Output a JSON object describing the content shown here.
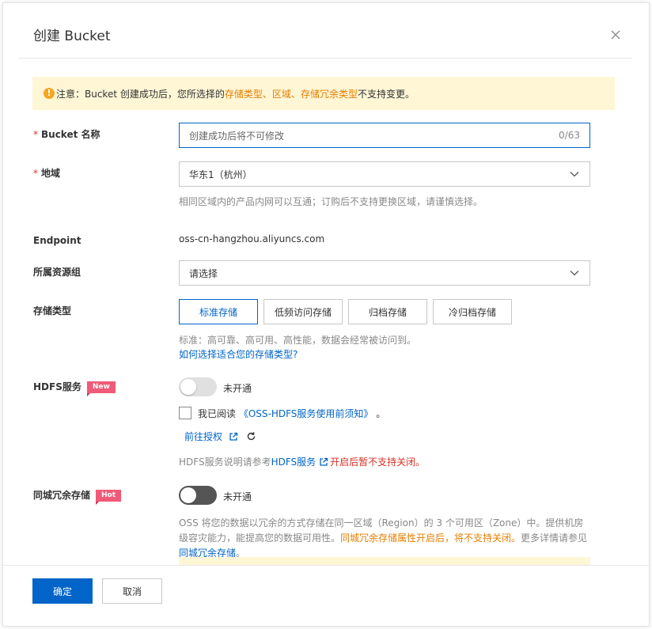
{
  "dialog": {
    "title": "创建 Bucket"
  },
  "notice": {
    "prefix": "注意：Bucket 创建成功后，您所选择的 ",
    "highlight1": "存储类型",
    "sep1": "、",
    "highlight2": "区域",
    "sep2": "、",
    "highlight3": "存储冗余类型",
    "suffix": " 不支持变更。"
  },
  "form": {
    "bucket_name": {
      "label": "Bucket 名称",
      "value": "创建成功后将不可修改",
      "counter": "0/63"
    },
    "region": {
      "label": "地域",
      "value": "华东1（杭州）",
      "help": "相同区域内的产品内网可以互通；订购后不支持更换区域，请谨慎选择。"
    },
    "endpoint": {
      "label": "Endpoint",
      "value": "oss-cn-hangzhou.aliyuncs.com"
    },
    "resource_group": {
      "label": "所属资源组",
      "value": "请选择"
    },
    "storage_type": {
      "label": "存储类型",
      "options": [
        "标准存储",
        "低频访问存储",
        "归档存储",
        "冷归档存储"
      ],
      "help": "标准：高可靠、高可用、高性能，数据会经常被访问到。",
      "link": "如何选择适合您的存储类型?"
    },
    "hdfs": {
      "label": "HDFS服务",
      "badge": "New",
      "toggle_text": "未开通",
      "checkbox_prefix": "我已阅读",
      "checkbox_link": "《OSS-HDFS服务使用前须知》",
      "checkbox_suffix": "。",
      "auth_link": "前往授权",
      "note_prefix": "HDFS服务说明请参考",
      "note_link": "HDFS服务",
      "note_warn": "开启后暂不支持关闭。"
    },
    "zrs": {
      "label": "同城冗余存储",
      "badge": "Hot",
      "toggle_text": "未开通",
      "desc_prefix": "OSS 将您的数据以冗余的方式存储在同一区域（Region）的 3 个可用区（Zone）中。提供机房级容灾能力，能提高您的数据可用性。",
      "desc_warn": "同城冗余存储属性开启后，将不支持关闭。",
      "desc_more": "更多详情请参见 ",
      "desc_link": "同城冗余存储",
      "desc_end": "。"
    }
  },
  "footer": {
    "confirm": "确定",
    "cancel": "取消"
  },
  "colors": {
    "primary": "#0064c8",
    "warning_bg": "#fff6d6",
    "highlight": "#e67e00",
    "danger": "#d93026",
    "badge": "#f05a78"
  },
  "icons": {
    "close": "close-icon",
    "warning": "warning-icon",
    "chevron": "chevron-down-icon",
    "external": "external-link-icon",
    "refresh": "refresh-icon"
  }
}
